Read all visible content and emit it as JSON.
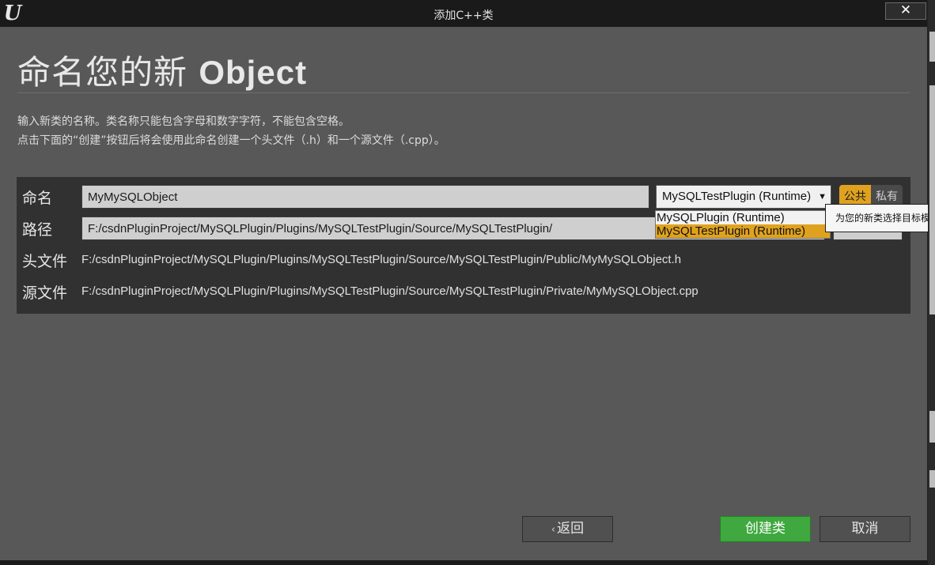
{
  "window": {
    "title": "添加C++类",
    "logo": "unreal-logo",
    "close_icon": "✕"
  },
  "heading": {
    "prefix": "命名您的新 ",
    "class_type": "Object"
  },
  "description": {
    "line1": "输入新类的名称。类名称只能包含字母和数字字符，不能包含空格。",
    "line2": "点击下面的“创建”按钮后将会使用此命名创建一个头文件（.h）和一个源文件（.cpp）。"
  },
  "form": {
    "name_label": "命名",
    "name_value": "MyMySQLObject",
    "path_label": "路径",
    "path_value": "F:/csdnPluginProject/MySQLPlugin/Plugins/MySQLTestPlugin/Source/MySQLTestPlugin/",
    "header_label": "头文件",
    "header_value": "F:/csdnPluginProject/MySQLPlugin/Plugins/MySQLTestPlugin/Source/MySQLTestPlugin/Public/MyMySQLObject.h",
    "source_label": "源文件",
    "source_value": "F:/csdnPluginProject/MySQLPlugin/Plugins/MySQLTestPlugin/Source/MySQLTestPlugin/Private/MyMySQLObject.cpp"
  },
  "module": {
    "selected": "MySQLTestPlugin (Runtime)",
    "options": [
      "MySQLPlugin (Runtime)",
      "MySQLTestPlugin (Runtime)"
    ],
    "selected_index": 1,
    "tooltip": "为您的新类选择目标模块"
  },
  "visibility": {
    "public_label": "公共",
    "private_label": "私有",
    "active": "public"
  },
  "buttons": {
    "back": "返回",
    "create": "创建类",
    "cancel": "取消"
  },
  "colors": {
    "accent": "#e0a21e",
    "create_button": "#3fa83f",
    "background": "#585858",
    "panel": "#313131"
  }
}
